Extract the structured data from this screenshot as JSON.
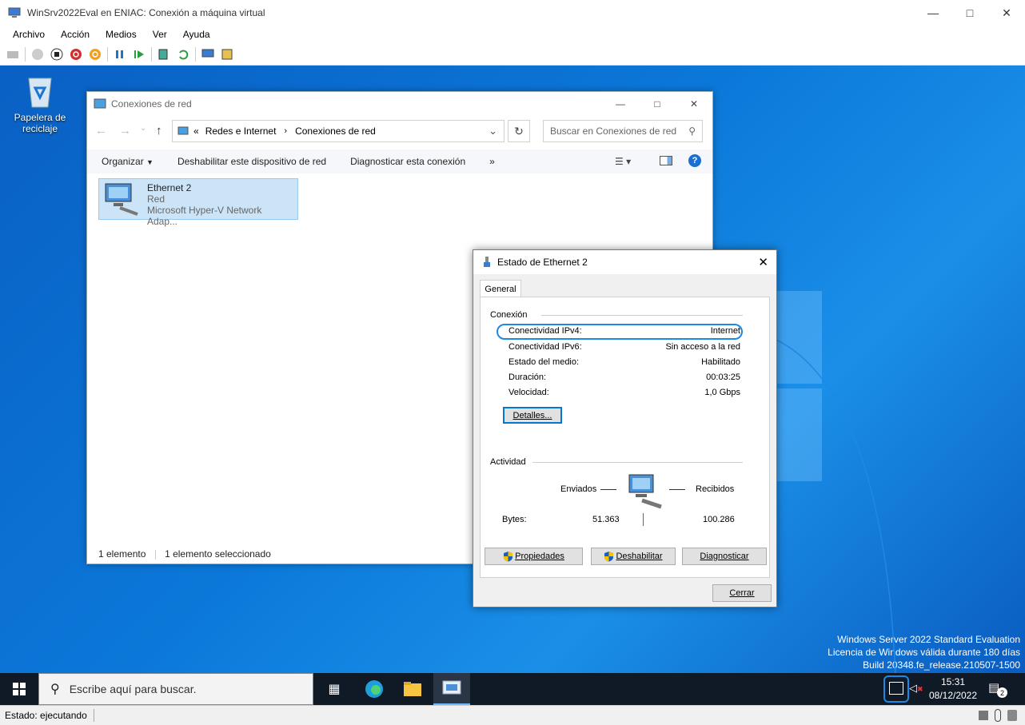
{
  "vm_window": {
    "title": "WinSrv2022Eval en ENIAC: Conexión a máquina virtual",
    "menu": [
      "Archivo",
      "Acción",
      "Medios",
      "Ver",
      "Ayuda"
    ],
    "status": "Estado: ejecutando"
  },
  "desktop": {
    "recycle_bin": "Papelera de reciclaje",
    "watermark": [
      "Windows Server 2022 Standard Evaluation",
      "Licencia de Windows válida durante 180 días",
      "Build 20348.fe_release.210507-1500"
    ]
  },
  "taskbar": {
    "search_placeholder": "Escribe aquí para buscar.",
    "time": "15:31",
    "date": "08/12/2022",
    "notification_count": "2"
  },
  "explorer": {
    "title": "Conexiones de red",
    "breadcrumb": [
      "Redes e Internet",
      "Conexiones de red"
    ],
    "breadcrumb_prefix": "«",
    "search_placeholder": "Buscar en Conexiones de red",
    "commands": [
      "Organizar",
      "Deshabilitar este dispositivo de red",
      "Diagnosticar esta conexión"
    ],
    "more": "»",
    "item": {
      "name": "Ethernet 2",
      "network": "Red",
      "adapter": "Microsoft Hyper-V Network Adap..."
    },
    "status_count": "1 elemento",
    "status_selected": "1 elemento seleccionado"
  },
  "dialog": {
    "title": "Estado de Ethernet 2",
    "tab": "General",
    "connection_header": "Conexión",
    "rows": [
      {
        "label": "Conectividad IPv4:",
        "value": "Internet"
      },
      {
        "label": "Conectividad IPv6:",
        "value": "Sin acceso a la red"
      },
      {
        "label": "Estado del medio:",
        "value": "Habilitado"
      },
      {
        "label": "Duración:",
        "value": "00:03:25"
      },
      {
        "label": "Velocidad:",
        "value": "1,0 Gbps"
      }
    ],
    "details_button": "Detalles...",
    "activity_header": "Actividad",
    "sent_label": "Enviados",
    "received_label": "Recibidos",
    "bytes_label": "Bytes:",
    "bytes_sent": "51.363",
    "bytes_received": "100.286",
    "properties_button": "Propiedades",
    "disable_button": "Deshabilitar",
    "diagnose_button": "Diagnosticar",
    "close_button": "Cerrar"
  },
  "colors": {
    "accent": "#0078d4",
    "highlight": "#1e88e5",
    "desktop": "#0b78d9",
    "taskbar": "#101a26"
  }
}
